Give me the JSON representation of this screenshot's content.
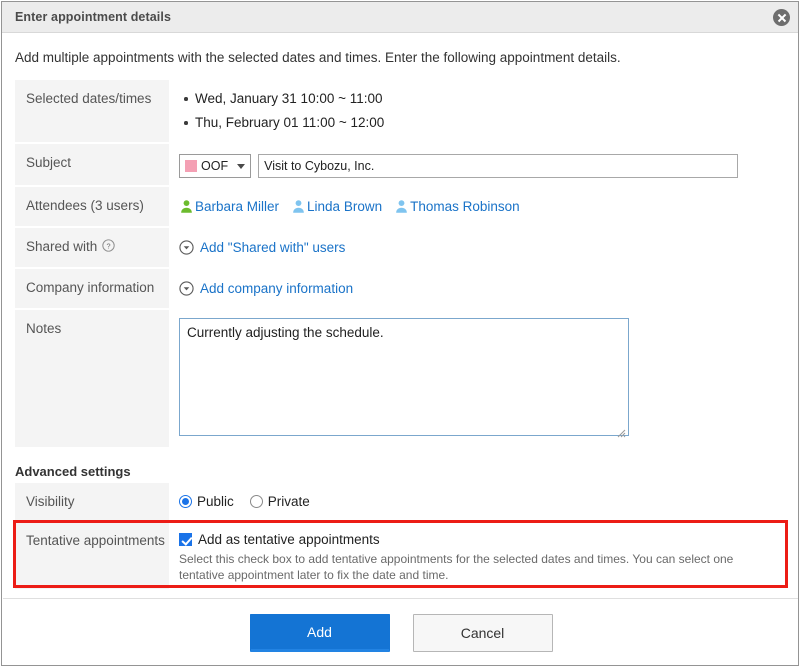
{
  "dialog": {
    "title": "Enter appointment details",
    "close_icon": "close-icon",
    "intro": "Add multiple appointments with the selected dates and times. Enter the following appointment details."
  },
  "form": {
    "selected_dates": {
      "label": "Selected dates/times",
      "items": [
        "Wed, January 31 10:00 ~ 11:00",
        "Thu, February 01 11:00 ~ 12:00"
      ]
    },
    "subject": {
      "label": "Subject",
      "menu_value": "OOF",
      "menu_swatch_color": "#f4a0b4",
      "caret_icon": "chevron-down-icon",
      "input_value": "Visit to Cybozu, Inc.",
      "input_placeholder": ""
    },
    "attendees": {
      "label": "Attendees (3 users)",
      "users": [
        {
          "name": "Barbara Miller",
          "icon": "user-icon",
          "icon_color": "#6cbb2e"
        },
        {
          "name": "Linda Brown",
          "icon": "user-icon",
          "icon_color": "#7fc4ef"
        },
        {
          "name": "Thomas Robinson",
          "icon": "user-icon",
          "icon_color": "#7fc4ef"
        }
      ]
    },
    "shared_with": {
      "label": "Shared with",
      "help_icon": "help-circle-icon",
      "link_label": "Add \"Shared with\" users",
      "link_icon": "chevron-down-circle-icon"
    },
    "company_information": {
      "label": "Company information",
      "link_label": "Add company information",
      "link_icon": "chevron-down-circle-icon"
    },
    "notes": {
      "label": "Notes",
      "value": "Currently adjusting the schedule.",
      "placeholder": ""
    }
  },
  "advanced": {
    "heading": "Advanced settings",
    "visibility": {
      "label": "Visibility",
      "options": [
        {
          "label": "Public",
          "selected": true
        },
        {
          "label": "Private",
          "selected": false
        }
      ]
    },
    "tentative": {
      "label": "Tentative appointments",
      "checkbox_label": "Add as tentative appointments",
      "checked": true,
      "help_text": "Select this check box to add tentative appointments for the selected dates and times. You can select one tentative appointment later to fix the date and time.",
      "highlight_color": "#ec1c16"
    }
  },
  "footer": {
    "add_label": "Add",
    "cancel_label": "Cancel",
    "primary_color": "#1474d4"
  }
}
